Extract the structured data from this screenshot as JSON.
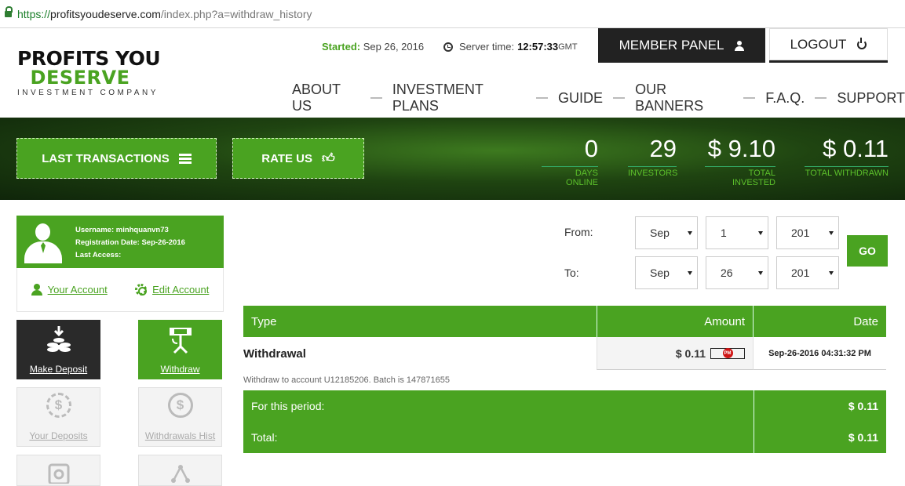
{
  "browser": {
    "url_proto": "https://",
    "url_host": "profitsyoudeserve.com",
    "url_path": "/index.php?a=withdraw_history"
  },
  "logo": {
    "line1": "PROFITS YOU",
    "line2": "DESERVE",
    "line3": "INVESTMENT COMPANY"
  },
  "header": {
    "started_label": "Started:",
    "started_value": "Sep 26, 2016",
    "server_time_label": "Server time:",
    "server_time_value": "12:57:33",
    "server_time_zone": "GMT",
    "member_panel": "MEMBER PANEL",
    "logout": "LOGOUT"
  },
  "nav": [
    "ABOUT US",
    "INVESTMENT PLANS",
    "GUIDE",
    "OUR BANNERS",
    "F.A.Q.",
    "SUPPORT"
  ],
  "banner": {
    "last_transactions": "LAST TRANSACTIONS",
    "rate_us": "RATE US",
    "stats": [
      {
        "value": "0",
        "label": "DAYS ONLINE"
      },
      {
        "value": "29",
        "label": "INVESTORS"
      },
      {
        "value": "$ 9.10",
        "label": "TOTAL INVESTED"
      },
      {
        "value": "$ 0.11",
        "label": "TOTAL WITHDRAWN"
      }
    ]
  },
  "profile": {
    "username": "Username: minhquanvn73",
    "registration": "Registration Date: Sep-26-2016",
    "last_access": "Last Access:",
    "your_account": "Your Account",
    "edit_account": "Edit Account"
  },
  "tiles": {
    "make_deposit": "Make Deposit",
    "withdraw": "Withdraw",
    "your_deposits": "Your Deposits",
    "withdrawals_hist": "Withdrawals Hist"
  },
  "filter": {
    "from_label": "From:",
    "to_label": "To:",
    "from_month": "Sep",
    "from_day": "1",
    "from_year": "201",
    "to_month": "Sep",
    "to_day": "26",
    "to_year": "201",
    "go": "GO"
  },
  "table": {
    "headers": {
      "type": "Type",
      "amount": "Amount",
      "date": "Date"
    },
    "rows": [
      {
        "type": "Withdrawal",
        "amount": "$ 0.11",
        "badge": "PM",
        "date": "Sep-26-2016 04:31:32 PM",
        "note": "Withdraw to account U12185206. Batch is 147871655"
      }
    ],
    "period_label": "For this period:",
    "period_value": "$ 0.11",
    "total_label": "Total:",
    "total_value": "$ 0.11"
  },
  "colors": {
    "brand_green": "#4aa321",
    "dark": "#222222"
  }
}
